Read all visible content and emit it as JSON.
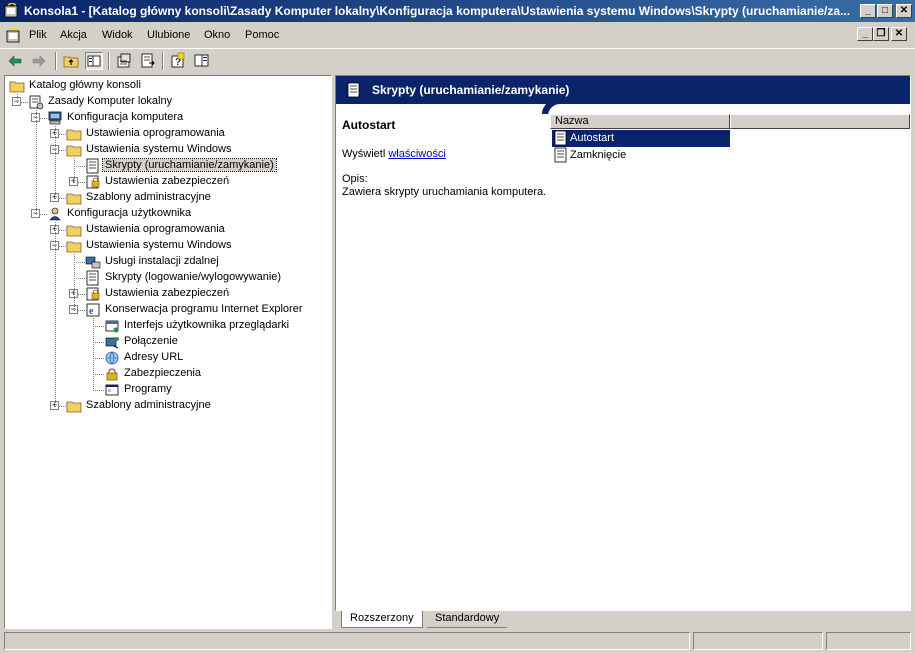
{
  "window": {
    "title": "Konsola1 - [Katalog główny konsoli\\Zasady Komputer lokalny\\Konfiguracja komputera\\Ustawienia systemu Windows\\Skrypty (uruchamianie/za...",
    "controls": {
      "minimize": "_",
      "maximize": "□",
      "close": "✕"
    }
  },
  "menu": [
    "Plik",
    "Akcja",
    "Widok",
    "Ulubione",
    "Okno",
    "Pomoc"
  ],
  "mdi_controls": {
    "minimize": "_",
    "restore": "❐",
    "close": "✕"
  },
  "toolbar": {
    "buttons": [
      "back-icon",
      "forward-icon",
      "up-folder-icon",
      "show-hide-tree-icon",
      "properties-icon",
      "export-list-icon",
      "help-icon",
      "show-hide-action-pane-icon"
    ]
  },
  "tree": [
    {
      "label": "Katalog główny konsoli",
      "icon": "folder-icon",
      "level": 0,
      "expander": ""
    },
    {
      "label": "Zasady Komputer lokalny",
      "icon": "policy-icon",
      "level": 1,
      "expander": "−"
    },
    {
      "label": "Konfiguracja komputera",
      "icon": "computer-icon",
      "level": 2,
      "expander": "−"
    },
    {
      "label": "Ustawienia oprogramowania",
      "icon": "folder-icon",
      "level": 3,
      "expander": "+"
    },
    {
      "label": "Ustawienia systemu Windows",
      "icon": "folder-icon",
      "level": 3,
      "expander": "−"
    },
    {
      "label": "Skrypty (uruchamianie/zamykanie)",
      "icon": "script-icon",
      "level": 4,
      "expander": "",
      "selected": true
    },
    {
      "label": "Ustawienia zabezpieczeń",
      "icon": "security-icon",
      "level": 4,
      "expander": "+"
    },
    {
      "label": "Szablony administracyjne",
      "icon": "folder-icon",
      "level": 3,
      "expander": "+"
    },
    {
      "label": "Konfiguracja użytkownika",
      "icon": "user-icon",
      "level": 2,
      "expander": "−"
    },
    {
      "label": "Ustawienia oprogramowania",
      "icon": "folder-icon",
      "level": 3,
      "expander": "+"
    },
    {
      "label": "Ustawienia systemu Windows",
      "icon": "folder-icon",
      "level": 3,
      "expander": "−"
    },
    {
      "label": "Usługi instalacji zdalnej",
      "icon": "remote-install-icon",
      "level": 4,
      "expander": ""
    },
    {
      "label": "Skrypty (logowanie/wylogowywanie)",
      "icon": "script-icon",
      "level": 4,
      "expander": ""
    },
    {
      "label": "Ustawienia zabezpieczeń",
      "icon": "security-icon",
      "level": 4,
      "expander": "+"
    },
    {
      "label": "Konserwacja programu Internet Explorer",
      "icon": "ie-maintenance-icon",
      "level": 4,
      "expander": "−"
    },
    {
      "label": "Interfejs użytkownika przeglądarki",
      "icon": "browser-ui-icon",
      "level": 5,
      "expander": ""
    },
    {
      "label": "Połączenie",
      "icon": "connection-icon",
      "level": 5,
      "expander": ""
    },
    {
      "label": "Adresy URL",
      "icon": "url-icon",
      "level": 5,
      "expander": ""
    },
    {
      "label": "Zabezpieczenia",
      "icon": "lock-icon",
      "level": 5,
      "expander": ""
    },
    {
      "label": "Programy",
      "icon": "programs-icon",
      "level": 5,
      "expander": ""
    },
    {
      "label": "Szablony administracyjne",
      "icon": "folder-icon",
      "level": 3,
      "expander": "+"
    }
  ],
  "detail": {
    "header_title": "Skrypty (uruchamianie/zamykanie)",
    "item_name": "Autostart",
    "show_prefix": "Wyświetl",
    "properties_link": "właściwości",
    "description_label": "Opis:",
    "description": "Zawiera skrypty uruchamiania komputera."
  },
  "list": {
    "column_header": "Nazwa",
    "items": [
      {
        "label": "Autostart",
        "selected": true
      },
      {
        "label": "Zamknięcie",
        "selected": false
      }
    ]
  },
  "tabs": [
    {
      "label": "Rozszerzony",
      "active": true
    },
    {
      "label": "Standardowy",
      "active": false
    }
  ],
  "colors": {
    "header_blue": "#0a246a",
    "title_gradient_end": "#3a6ea5",
    "folder_yellow": "#f0d060",
    "window_bg": "#d4d0c8"
  }
}
